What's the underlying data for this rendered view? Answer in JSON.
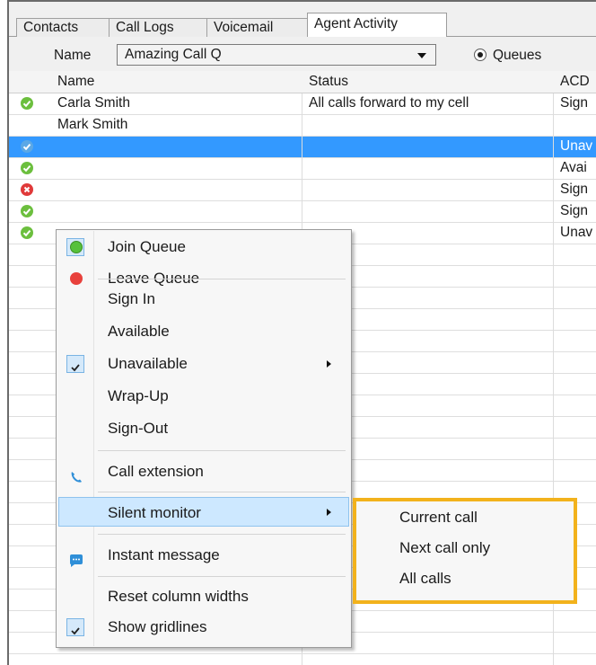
{
  "tabs": [
    {
      "label": "Contacts"
    },
    {
      "label": "Call Logs"
    },
    {
      "label": "Voicemail"
    },
    {
      "label": "Agent Activity"
    }
  ],
  "toolbar": {
    "name_label": "Name",
    "combo_value": "Amazing Call Q",
    "radio_label": "Queues"
  },
  "table": {
    "columns": [
      "Name",
      "Status",
      "ACD"
    ],
    "rows": [
      {
        "name": "Carla Smith",
        "status": "All calls forward to my cell",
        "acd": "Sign",
        "icon": "green-check-icon"
      },
      {
        "name": "Mark Smith",
        "status": "",
        "acd": "",
        "icon": ""
      },
      {
        "name": "",
        "status": "",
        "acd": "Unav",
        "icon": "blue-check-icon"
      },
      {
        "name": "",
        "status": "",
        "acd": "Avai",
        "icon": "green-check-icon"
      },
      {
        "name": "",
        "status": "",
        "acd": "Sign",
        "icon": "red-x-icon"
      },
      {
        "name": "",
        "status": "",
        "acd": "Sign",
        "icon": "green-check-icon"
      },
      {
        "name": "",
        "status": "",
        "acd": "Unav",
        "icon": "green-check-icon"
      }
    ]
  },
  "context_menu": {
    "items": [
      {
        "label": "Join Queue",
        "icon": "green-circle-icon"
      },
      {
        "label": "Leave Queue",
        "icon": "red-circle-icon"
      },
      {
        "label": "Sign In",
        "icon": ""
      },
      {
        "label": "Available",
        "icon": ""
      },
      {
        "label": "Unavailable",
        "icon": "checkmark-icon"
      },
      {
        "label": "Wrap-Up",
        "icon": ""
      },
      {
        "label": "Sign-Out",
        "icon": ""
      },
      {
        "label": "Call extension",
        "icon": "phone-icon"
      },
      {
        "label": "Silent monitor",
        "icon": ""
      },
      {
        "label": "Instant message",
        "icon": "chat-bubble-icon"
      },
      {
        "label": "Reset column widths",
        "icon": ""
      },
      {
        "label": "Show gridlines",
        "icon": "checkmark-icon"
      }
    ]
  },
  "submenu": {
    "items": [
      {
        "label": "Current call"
      },
      {
        "label": "Next call only"
      },
      {
        "label": "All calls"
      }
    ]
  },
  "colors": {
    "selection": "#3399ff",
    "menu_highlight": "#cde8ff",
    "submenu_outline": "#f2b21c"
  }
}
